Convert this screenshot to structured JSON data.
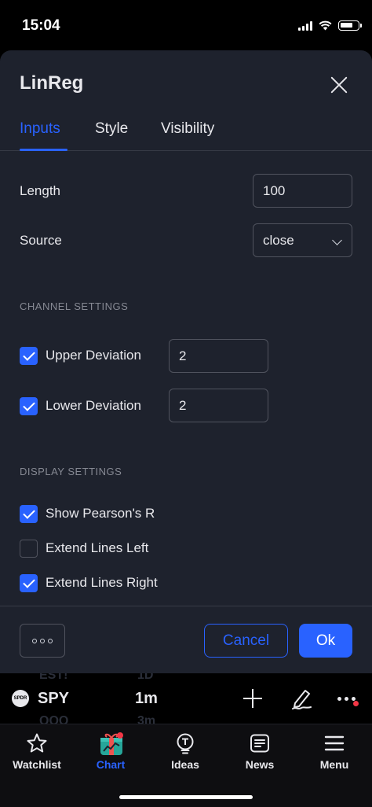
{
  "status_bar": {
    "time": "15:04"
  },
  "dialog": {
    "title": "LinReg",
    "tabs": [
      {
        "label": "Inputs",
        "active": true
      },
      {
        "label": "Style",
        "active": false
      },
      {
        "label": "Visibility",
        "active": false
      }
    ],
    "inputs": {
      "length_label": "Length",
      "length_value": "100",
      "source_label": "Source",
      "source_value": "close"
    },
    "channel_settings": {
      "title": "CHANNEL SETTINGS",
      "upper": {
        "label": "Upper Deviation",
        "checked": true,
        "value": "2"
      },
      "lower": {
        "label": "Lower Deviation",
        "checked": true,
        "value": "2"
      }
    },
    "display_settings": {
      "title": "DISPLAY SETTINGS",
      "items": [
        {
          "label": "Show Pearson's R",
          "checked": true
        },
        {
          "label": "Extend Lines Left",
          "checked": false
        },
        {
          "label": "Extend Lines Right",
          "checked": true
        }
      ]
    },
    "footer": {
      "cancel_label": "Cancel",
      "ok_label": "Ok"
    }
  },
  "chart_toolbar": {
    "symbol_logo": "SPDR",
    "symbol": "SPY",
    "interval": "1m",
    "ghost_above": [
      "EST!",
      "1D"
    ],
    "ghost_below": [
      "QQQ",
      "3m"
    ]
  },
  "tab_bar": {
    "items": [
      {
        "label": "Watchlist",
        "icon": "star-icon",
        "active": false
      },
      {
        "label": "Chart",
        "icon": "chart-gift-icon",
        "active": true
      },
      {
        "label": "Ideas",
        "icon": "lightbulb-icon",
        "active": false
      },
      {
        "label": "News",
        "icon": "newspaper-icon",
        "active": false
      },
      {
        "label": "Menu",
        "icon": "hamburger-icon",
        "active": false
      }
    ]
  },
  "colors": {
    "accent": "#2962ff",
    "dialog_bg": "#1e222d",
    "notification": "#f23645"
  }
}
